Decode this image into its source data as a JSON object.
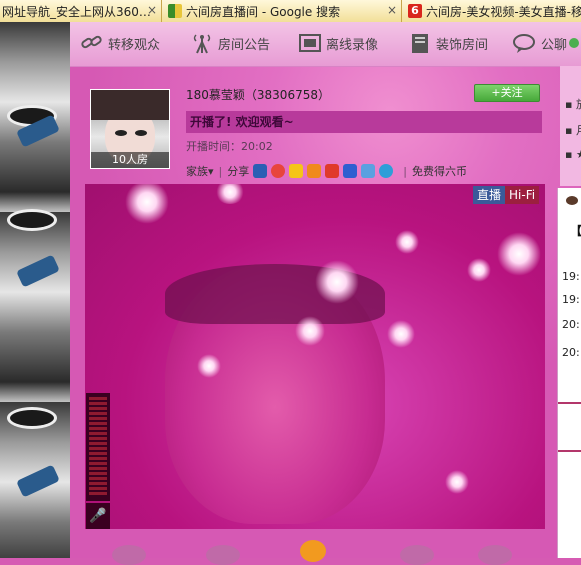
{
  "browser": {
    "tabs": [
      {
        "label": "网址导航_安全上网从360…",
        "close": "×",
        "fav_color": "#ffffff"
      },
      {
        "label": "六间房直播间 - Google 搜索",
        "close": "×",
        "fav_color": "#3a8d2a"
      },
      {
        "label": "六间房-美女视频-美女直播-移",
        "badge": "6",
        "fav_color": "#d9261c"
      }
    ]
  },
  "nav": {
    "items": [
      {
        "label": "转移观众",
        "icon": "link-chain-icon"
      },
      {
        "label": "房间公告",
        "icon": "antenna-icon"
      },
      {
        "label": "离线录像",
        "icon": "film-icon"
      },
      {
        "label": "装饰房间",
        "icon": "gift-box-icon"
      },
      {
        "label": "公聊",
        "icon": "chat-bubble-icon"
      }
    ]
  },
  "anchor": {
    "name_line": "180慕莹颖（38306758）",
    "follow_label": "+关注",
    "welcome": "开播了! 欢迎观看~",
    "start_time": "开播时间：20:02",
    "room_label": "10人房",
    "family_label": "家族▾",
    "share_label": "分享",
    "free_coins_label": "免费得六币",
    "separator": "|"
  },
  "video": {
    "live_label": "直播",
    "quality_label": "Hi-Fi",
    "mic_icon": "🎤"
  },
  "right_panel": {
    "bullets": [
      "▪ 放",
      "▪ 月",
      "▪ ★"
    ],
    "chat_times": [
      "19:",
      "19:",
      "20:",
      "20:"
    ],
    "bracket": "【"
  }
}
